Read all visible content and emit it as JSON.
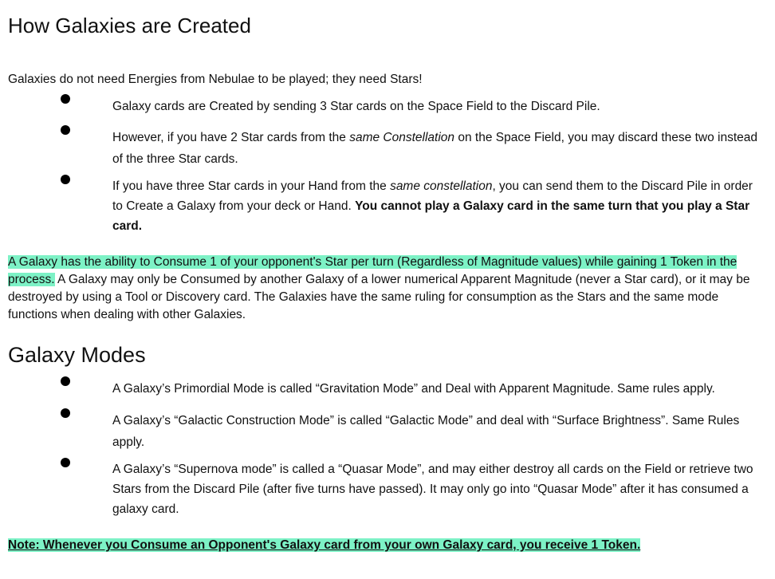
{
  "section1": {
    "title": "How Galaxies are Created",
    "intro": "Galaxies do not need Energies from Nebulae to be played; they need Stars!",
    "bullets": [
      {
        "text": "Galaxy cards are Created by sending 3 Star cards on the Space Field to the Discard Pile."
      },
      {
        "pre": "However, if you have 2 Star cards from the ",
        "em": "same Constellation",
        "post": " on the Space Field, you may discard these two instead of the three Star cards."
      },
      {
        "pre": "If you have three Star cards in your Hand from the ",
        "em": "same constellation",
        "post": ", you can send them to the Discard Pile in order to Create a Galaxy from your deck or Hand. ",
        "bold": "You cannot play a Galaxy card in the same turn that you play a Star card."
      }
    ],
    "para_highlight": "A Galaxy has the ability to Consume 1 of your opponent's Star per turn (Regardless of Magnitude values) while gaining 1 Token in the process.",
    "para_rest": " A Galaxy may only be Consumed by another Galaxy of a lower numerical Apparent Magnitude (never a Star card), or it may be destroyed by using a Tool or Discovery card. The Galaxies have the same ruling for consumption as the Stars and the same mode functions when dealing with other Galaxies."
  },
  "section2": {
    "title": "Galaxy Modes",
    "bullets": [
      "A Galaxy’s Primordial Mode is called “Gravitation Mode” and Deal with Apparent Magnitude. Same rules apply.",
      "A Galaxy’s “Galactic Construction Mode” is called “Galactic Mode” and deal with “Surface Brightness”. Same Rules apply.",
      "A Galaxy’s “Supernova mode” is called a “Quasar Mode”, and may either destroy all cards on the Field or retrieve two Stars from the Discard Pile (after five turns have passed). It may only go into “Quasar Mode” after it has consumed a galaxy card."
    ],
    "note": "Note: Whenever you Consume an Opponent's Galaxy card from your own Galaxy card, you receive 1 Token."
  },
  "colors": {
    "highlight": "#7df2c6",
    "text": "#111111"
  }
}
